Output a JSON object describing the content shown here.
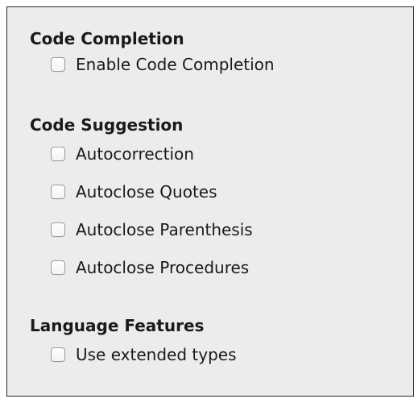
{
  "sections": [
    {
      "title": "Code Completion",
      "options": [
        {
          "label": "Enable Code Completion",
          "checked": false
        }
      ]
    },
    {
      "title": "Code Suggestion",
      "options": [
        {
          "label": "Autocorrection",
          "checked": false
        },
        {
          "label": "Autoclose Quotes",
          "checked": false
        },
        {
          "label": "Autoclose Parenthesis",
          "checked": false
        },
        {
          "label": "Autoclose Procedures",
          "checked": false
        }
      ]
    },
    {
      "title": "Language Features",
      "options": [
        {
          "label": "Use extended types",
          "checked": false
        }
      ]
    }
  ]
}
